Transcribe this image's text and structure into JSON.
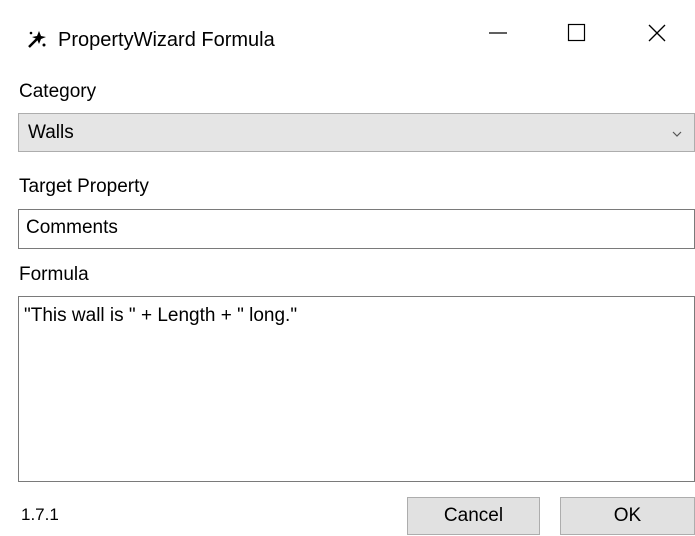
{
  "window": {
    "title": "PropertyWizard Formula",
    "app_icon": "wizard-icon",
    "controls": [
      "minimize-icon",
      "maximize-icon",
      "close-icon"
    ]
  },
  "category": {
    "label": "Category",
    "selected": "Walls"
  },
  "target_property": {
    "label": "Target Property",
    "value": "Comments"
  },
  "formula": {
    "label": "Formula",
    "value": "\"This wall is \" + Length + \" long.\""
  },
  "footer": {
    "version": "1.7.1",
    "cancel_label": "Cancel",
    "ok_label": "OK"
  }
}
